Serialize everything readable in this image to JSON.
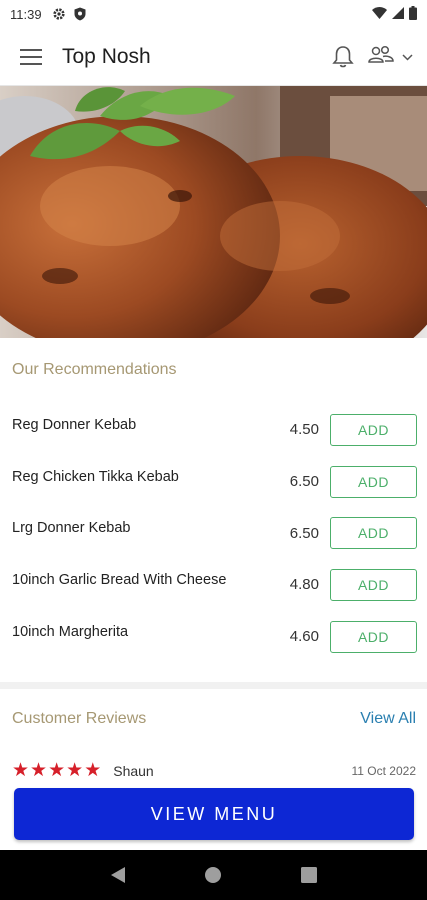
{
  "status_bar": {
    "time": "11:39",
    "icons": [
      "settings-gear-icon",
      "shield-icon",
      "wifi-icon",
      "signal-icon",
      "battery-icon"
    ]
  },
  "app_bar": {
    "title": "Top Nosh",
    "icons": [
      "hamburger-menu-icon",
      "bell-icon",
      "people-icon",
      "chevron-down-icon"
    ]
  },
  "recommendations": {
    "title": "Our Recommendations",
    "add_label": "ADD",
    "items": [
      {
        "name": "Reg Donner Kebab",
        "price": "4.50"
      },
      {
        "name": "Reg Chicken Tikka Kebab",
        "price": "6.50"
      },
      {
        "name": "Lrg Donner Kebab",
        "price": "6.50"
      },
      {
        "name": "10inch Garlic Bread With Cheese",
        "price": "4.80"
      },
      {
        "name": "10inch Margherita",
        "price": "4.60"
      }
    ]
  },
  "reviews": {
    "title": "Customer Reviews",
    "view_all": "View All",
    "items": [
      {
        "rating": 5,
        "reviewer": "Shaun",
        "date": "11 Oct 2022"
      }
    ]
  },
  "cta": {
    "label": "VIEW MENU"
  },
  "colors": {
    "section_title": "#a69873",
    "add_button": "#4caf6a",
    "view_all_link": "#2a7fb0",
    "star": "#d6202a",
    "cta_background": "#0d27d4"
  }
}
